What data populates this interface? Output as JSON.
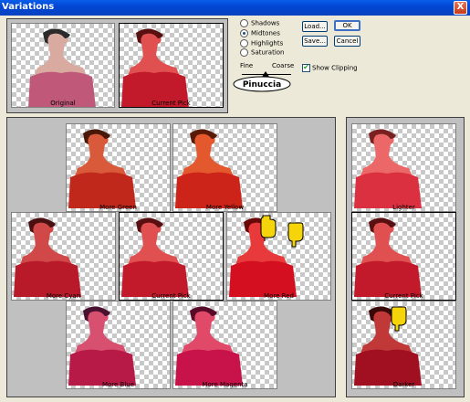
{
  "window": {
    "title": "Variations",
    "close_glyph": "X"
  },
  "top_thumbs": {
    "original": "Original",
    "current": "Current Pick"
  },
  "options": {
    "shadows": "Shadows",
    "midtones": "Midtones",
    "highlights": "Highlights",
    "saturation": "Saturation",
    "selected": "Midtones"
  },
  "buttons": {
    "load": "Load...",
    "ok": "OK",
    "save": "Save...",
    "cancel": "Cancel"
  },
  "slider": {
    "fine": "Fine",
    "coarse": "Coarse"
  },
  "logo_text": "Pinuccia",
  "show_clipping": {
    "label": "Show Clipping",
    "checked": true
  },
  "color_grid": {
    "more_green": "More Green",
    "more_yellow": "More Yellow",
    "more_cyan": "More Cyan",
    "current": "Current Pick",
    "more_red": "More Red",
    "more_blue": "More Blue",
    "more_magenta": "More Magenta"
  },
  "brightness": {
    "lighter": "Lighter",
    "current": "Current Pick",
    "darker": "Darker"
  },
  "colors": {
    "titlebar": "#0a5ee8",
    "panel": "#c0c0c0",
    "dialog": "#ece9d8"
  }
}
